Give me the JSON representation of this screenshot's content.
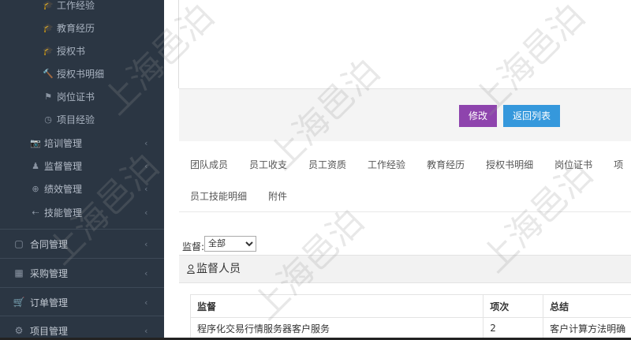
{
  "sidebar": {
    "sub_items": [
      {
        "icon": "graduation-cap-icon",
        "glyph": "🎓",
        "label": "工作经验"
      },
      {
        "icon": "graduation-cap-icon",
        "glyph": "🎓",
        "label": "教育经历"
      },
      {
        "icon": "graduation-cap-icon",
        "glyph": "🎓",
        "label": "授权书"
      },
      {
        "icon": "gavel-icon",
        "glyph": "🔨",
        "label": "授权书明细"
      },
      {
        "icon": "flag-icon",
        "glyph": "⚑",
        "label": "岗位证书"
      },
      {
        "icon": "clock-icon",
        "glyph": "◷",
        "label": "项目经验"
      }
    ],
    "mid_items": [
      {
        "icon": "camera-icon",
        "glyph": "📷",
        "label": "培训管理",
        "chevron": "‹"
      },
      {
        "icon": "person-icon",
        "glyph": "♟",
        "label": "监督管理",
        "chevron": "‹"
      },
      {
        "icon": "lifebuoy-icon",
        "glyph": "⊕",
        "label": "绩效管理",
        "chevron": "‹"
      },
      {
        "icon": "arrow-left-icon",
        "glyph": "⇠",
        "label": "技能管理",
        "chevron": "‹"
      }
    ],
    "top_items": [
      {
        "icon": "document-icon",
        "glyph": "▢",
        "label": "合同管理",
        "chevron": "‹"
      },
      {
        "icon": "table-icon",
        "glyph": "▦",
        "label": "采购管理",
        "chevron": "‹"
      },
      {
        "icon": "cart-icon",
        "glyph": "🛒",
        "label": "订单管理",
        "chevron": "‹"
      },
      {
        "icon": "cogs-icon",
        "glyph": "⚙",
        "label": "项目管理",
        "chevron": "‹"
      }
    ]
  },
  "toolbar": {
    "edit_label": "修改",
    "back_label": "返回列表"
  },
  "tabs": {
    "row1": [
      "团队成员",
      "员工收支",
      "员工资质",
      "工作经验",
      "教育经历",
      "授权书明细",
      "岗位证书",
      "项"
    ],
    "row2": [
      "员工技能明细",
      "附件"
    ]
  },
  "filter": {
    "label": "监督:",
    "selected": "全部"
  },
  "panel": {
    "title": "监督人员"
  },
  "table": {
    "headers": [
      "监督",
      "项次",
      "总结"
    ],
    "rows": [
      [
        "程序化交易行情服务器客户服务",
        "2",
        "客户计算方法明确"
      ]
    ]
  },
  "watermark": {
    "text": "上海邑泊"
  },
  "colors": {
    "sidebar_bg": "#2b3643",
    "edit_button": "#8e44ad",
    "back_button": "#3598dc"
  }
}
